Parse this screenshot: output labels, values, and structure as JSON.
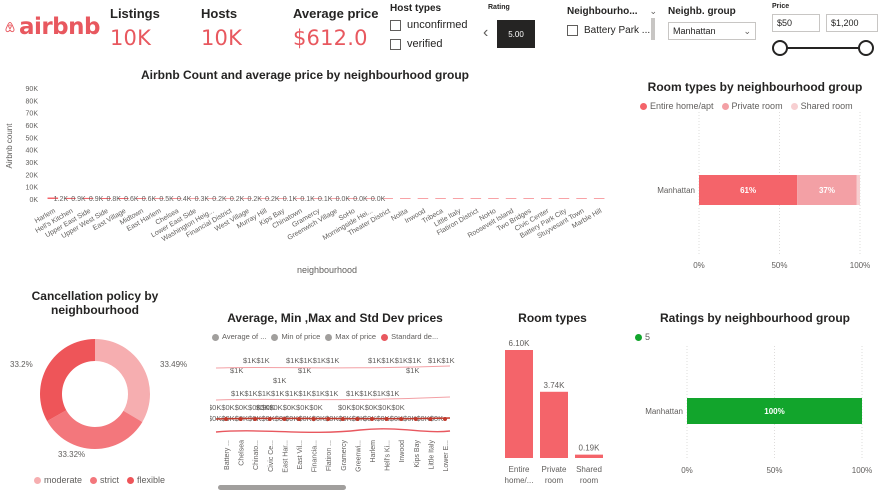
{
  "brand": {
    "name": "airbnb"
  },
  "kpis": [
    {
      "label": "Listings",
      "value": "10K"
    },
    {
      "label": "Hosts",
      "value": "10K"
    },
    {
      "label": "Average price",
      "value": "$612.0"
    }
  ],
  "host_types": {
    "title": "Host types",
    "options": [
      "unconfirmed",
      "verified"
    ]
  },
  "rating_slicer": {
    "title": "Rating",
    "value": "5.00"
  },
  "neighbourhood_slicer": {
    "title": "Neighbourho...",
    "option": "Battery Park ..."
  },
  "neigh_group_slicer": {
    "title": "Neighb. group",
    "selected": "Manhattan"
  },
  "price_slicer": {
    "title": "Price",
    "min": "$50",
    "max": "$1,200"
  },
  "colors": {
    "accent": "#e8585f",
    "bar": "#f4646a",
    "private": "#f3a0a5",
    "shared": "#f7cfd1",
    "green": "#12a52c",
    "donut": [
      "#f6aeb0",
      "#f3777c",
      "#ee5559"
    ]
  },
  "count_chart": {
    "title": "Airbnb Count and average price by neighbourhood group",
    "ylabel": "Airbnb count",
    "xlabel": "neighbourhood",
    "yticks": [
      "90K",
      "80K",
      "70K",
      "60K",
      "50K",
      "40K",
      "30K",
      "20K",
      "10K",
      "0K"
    ],
    "categories": [
      "Harlem",
      "Hell's Kitchen",
      "Upper East Side",
      "Upper West Side",
      "East Village",
      "Midtown",
      "East Harlem",
      "Chelsea",
      "Lower East Side",
      "Washington Heig...",
      "Financial District",
      "West Village",
      "Murray Hill",
      "Kips Bay",
      "Chinatown",
      "Gramercy",
      "Greenwich Village",
      "SoHo",
      "Morningside Hei...",
      "Theater District",
      "Nolita",
      "Inwood",
      "Tribeca",
      "Little Italy",
      "Flatiron District",
      "NoHo",
      "Roosevelt Island",
      "Two Bridges",
      "Civic Center",
      "Battery Park City",
      "Stuyvesant Town",
      "Marble Hill"
    ],
    "data_labels": [
      "1.2K",
      "0.9K",
      "0.9K",
      "0.8K",
      "0.6K",
      "0.6K",
      "0.5K",
      "0.4K",
      "0.3K",
      "0.2K",
      "0.2K",
      "0.2K",
      "0.2K",
      "0.1K",
      "0.1K",
      "0.1K",
      "0.0K",
      "0.0K",
      "0.0K"
    ]
  },
  "chart_data": [
    {
      "type": "bar",
      "title": "Airbnb Count and average price by neighbourhood group",
      "xlabel": "neighbourhood",
      "ylabel": "Airbnb count",
      "ylim": [
        0,
        90000
      ],
      "categories": [
        "Harlem",
        "Hell's Kitchen",
        "Upper East Side",
        "Upper West Side",
        "East Village",
        "Midtown",
        "East Harlem",
        "Chelsea",
        "Lower East Side",
        "Washington Heig...",
        "Financial District",
        "West Village",
        "Murray Hill",
        "Kips Bay",
        "Chinatown",
        "Gramercy",
        "Greenwich Village",
        "SoHo",
        "Morningside Hei...",
        "Theater District",
        "Nolita",
        "Inwood",
        "Tribeca",
        "Little Italy",
        "Flatiron District",
        "NoHo",
        "Roosevelt Island",
        "Two Bridges",
        "Civic Center",
        "Battery Park City",
        "Stuyvesant Town",
        "Marble Hill"
      ],
      "values": [
        1200,
        900,
        900,
        800,
        800,
        700,
        600,
        600,
        500,
        400,
        300,
        300,
        200,
        200,
        200,
        200,
        200,
        150,
        150,
        100,
        100,
        100,
        80,
        60,
        40,
        30,
        20,
        10,
        10,
        5,
        5,
        5
      ]
    },
    {
      "type": "bar",
      "title": "Room types by neighbourhood group",
      "categories": [
        "Manhattan"
      ],
      "series": [
        {
          "name": "Entire home/apt",
          "values": [
            61
          ]
        },
        {
          "name": "Private room",
          "values": [
            37
          ]
        },
        {
          "name": "Shared room",
          "values": [
            2
          ]
        }
      ],
      "xticks": [
        "0%",
        "50%",
        "100%"
      ]
    },
    {
      "type": "pie",
      "title": "Cancellation policy by neighbourhood",
      "labels": [
        "moderate",
        "strict",
        "flexible"
      ],
      "values": [
        33.49,
        33.32,
        33.2
      ],
      "value_labels": [
        "33.49%",
        "33.32%",
        "33.2%"
      ]
    },
    {
      "type": "line",
      "title": "Average, Min ,Max and Std Dev prices",
      "series": [
        {
          "name": "Average of ..."
        },
        {
          "name": "Min of price"
        },
        {
          "name": "Max of price"
        },
        {
          "name": "Standard de..."
        }
      ],
      "categories": [
        "Battery ...",
        "Chelsea",
        "Chinato...",
        "Civic Ce...",
        "East Har...",
        "East Vil...",
        "Financia...",
        "Flatiron ...",
        "Gramercy",
        "Greenwi...",
        "Harlem",
        "Hell's Ki...",
        "Inwood",
        "Kips Bay",
        "Little Italy",
        "Lower E..."
      ]
    },
    {
      "type": "bar",
      "title": "Room types",
      "categories": [
        "Entire home/...",
        "Private room",
        "Shared room"
      ],
      "values": [
        6100,
        3740,
        190
      ],
      "value_labels": [
        "6.10K",
        "3.74K",
        "0.19K"
      ]
    },
    {
      "type": "bar",
      "title": "Ratings by neighbourhood group",
      "categories": [
        "Manhattan"
      ],
      "series": [
        {
          "name": "5",
          "values": [
            100
          ]
        }
      ],
      "xticks": [
        "0%",
        "50%",
        "100%"
      ]
    }
  ],
  "room_by_group": {
    "title": "Room types by neighbourhood group",
    "legend": [
      "Entire home/apt",
      "Private room",
      "Shared room"
    ],
    "category": "Manhattan",
    "labels": [
      "61%",
      "37%"
    ],
    "xticks": [
      "0%",
      "50%",
      "100%"
    ]
  },
  "cancellation": {
    "title": "Cancellation policy by neighbourhood",
    "labels": [
      "33.49%",
      "33.32%",
      "33.2%"
    ],
    "legend": [
      "moderate",
      "strict",
      "flexible"
    ]
  },
  "price_stats": {
    "title": "Average, Min ,Max and Std Dev prices",
    "legend": [
      "Average of ...",
      "Min of price",
      "Max of price",
      "Standard de..."
    ],
    "row1": [
      "$1K$1K",
      "$1K$1K$1K$1K",
      "$1K$1K$1K$1K",
      "$1K$1K"
    ],
    "row1b": [
      "$1K",
      "$1K",
      "$1K"
    ],
    "row2": "$1K",
    "row3": [
      "$1K$1K$1K$1K",
      "$1K$1K$1K$1K",
      "$1K$1K$1K$1K"
    ],
    "row4": [
      "$0K$0K$0K$0K$0K",
      "$0K$0K$0K$0K$0K",
      "$0K$0K$0K$0K$0K"
    ],
    "row5": [
      "$0K$0K$0K$0K$0K$0K",
      "$0K$0K$0K$0K$0K$0K",
      "$0K$0K$0K$0K$0K$0K"
    ],
    "categories": [
      "Battery ...",
      "Chelsea",
      "Chinato...",
      "Civic Ce...",
      "East Har...",
      "East Vil...",
      "Financia...",
      "Flatiron ...",
      "Gramercy",
      "Greenwi...",
      "Harlem",
      "Hell's Ki...",
      "Inwood",
      "Kips Bay",
      "Little Italy",
      "Lower E..."
    ]
  },
  "room_types": {
    "title": "Room types",
    "value_labels": [
      "6.10K",
      "3.74K",
      "0.19K"
    ],
    "categories": [
      "Entire\nhome/...",
      "Private\nroom",
      "Shared\nroom"
    ]
  },
  "ratings": {
    "title": "Ratings by neighbourhood group",
    "legend": "5",
    "category": "Manhattan",
    "label": "100%",
    "xticks": [
      "0%",
      "50%",
      "100%"
    ]
  }
}
